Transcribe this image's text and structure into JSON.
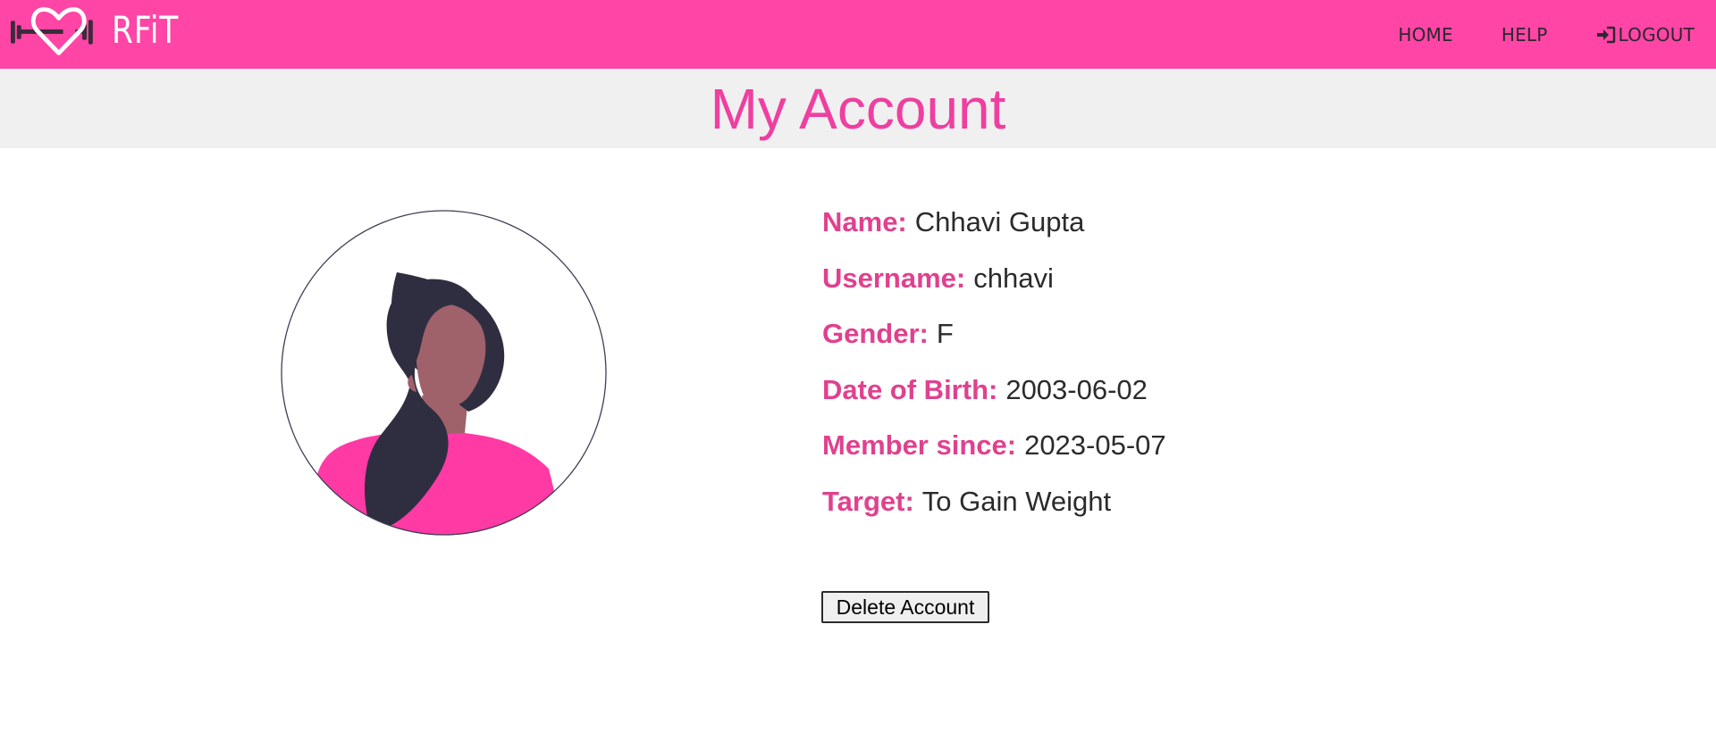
{
  "brand": {
    "name": "RFiT",
    "primary_color": "#ff45a5",
    "title_color": "#ef3fa0",
    "label_color": "#e0418e"
  },
  "nav": {
    "home": "HOME",
    "help": "HELP",
    "logout": "LOGOUT",
    "logout_icon": "sign-in-icon"
  },
  "page": {
    "title": "My Account"
  },
  "profile": {
    "avatar_icon": "female-avatar-icon",
    "fields": [
      {
        "label": "Name:",
        "value": "Chhavi Gupta"
      },
      {
        "label": "Username:",
        "value": "chhavi"
      },
      {
        "label": "Gender:",
        "value": "F"
      },
      {
        "label": "Date of Birth:",
        "value": "2003-06-02"
      },
      {
        "label": "Member since:",
        "value": "2023-05-07"
      },
      {
        "label": "Target:",
        "value": "To Gain Weight"
      }
    ]
  },
  "actions": {
    "delete_account": "Delete Account"
  }
}
